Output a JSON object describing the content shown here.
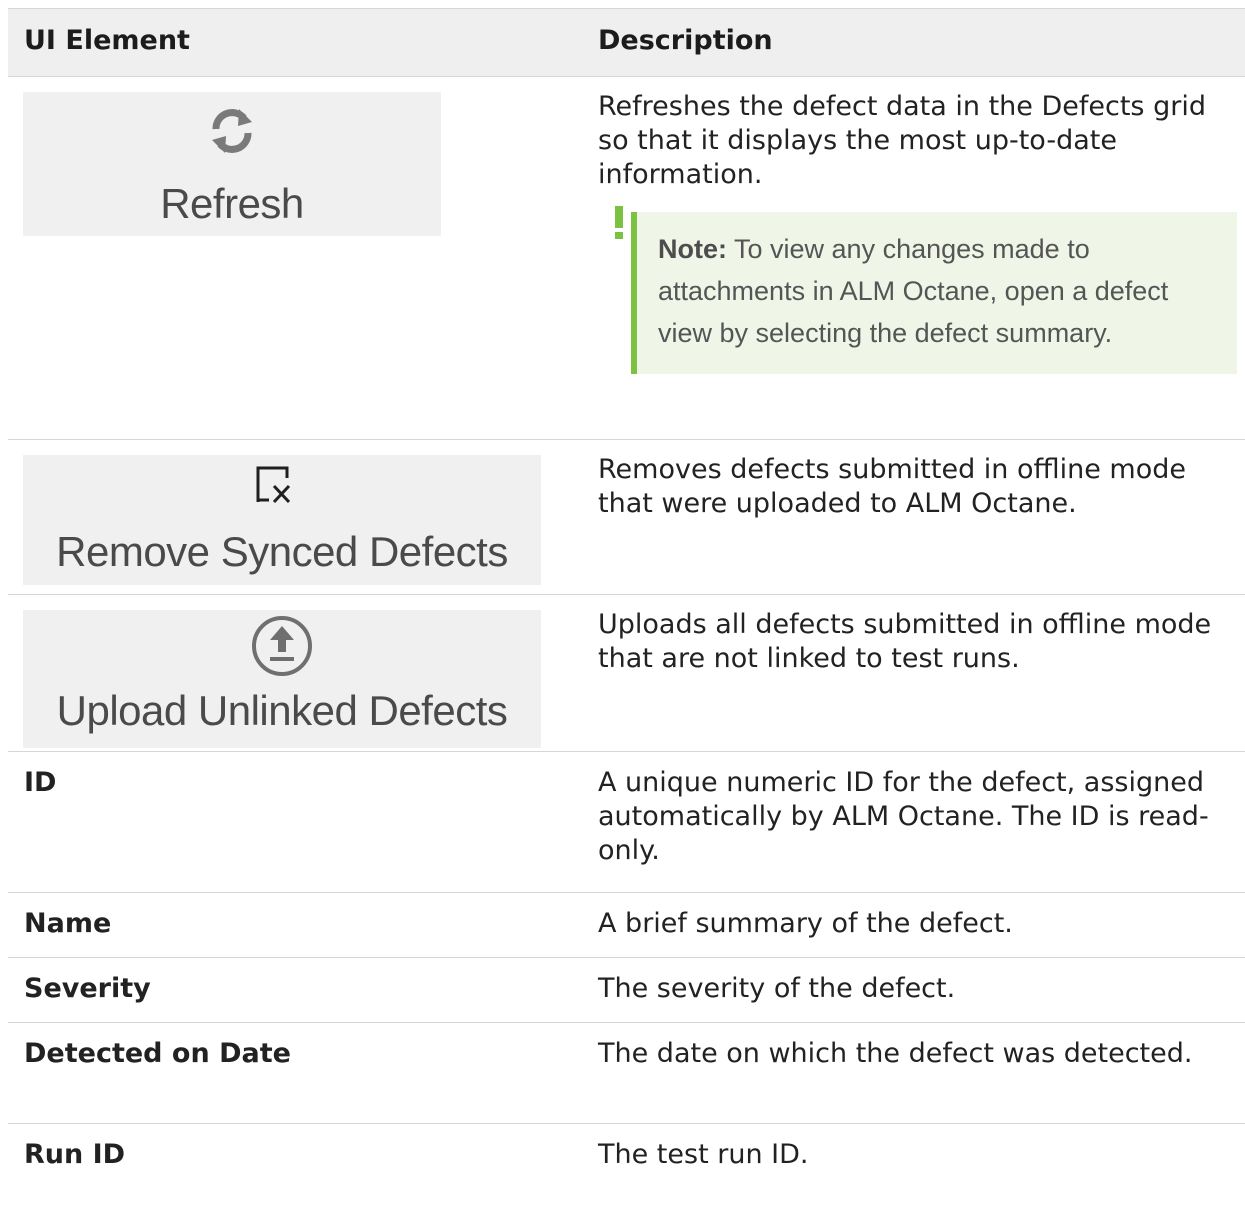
{
  "header": {
    "col_element": "UI Element",
    "col_description": "Description"
  },
  "rows": {
    "refresh": {
      "label": "Refresh",
      "icon": "refresh-icon",
      "description": "Refreshes the defect data in the Defects grid so that it displays the most up-to-date information.",
      "note_label": "Note:",
      "note_text": " To view any changes made to attachments in ALM Octane, open a defect view by selecting the defect summary."
    },
    "remove_synced": {
      "label": "Remove Synced Defects",
      "icon": "remove-synced-icon",
      "description": "Removes defects submitted in offline mode that were uploaded to ALM Octane."
    },
    "upload_unlinked": {
      "label": "Upload Unlinked Defects",
      "icon": "upload-icon",
      "description": "Uploads all defects submitted in offline mode that are not linked to test runs."
    },
    "id": {
      "label": "ID",
      "description": "A unique numeric ID for the defect, assigned automatically by ALM Octane. The ID is read-only."
    },
    "name": {
      "label": "Name",
      "description": "A brief summary of the defect."
    },
    "severity": {
      "label": "Severity",
      "description": "The severity of the defect."
    },
    "detected_on_date": {
      "label": "Detected on Date",
      "description": "The date on which the defect was detected."
    },
    "run_id": {
      "label": "Run ID",
      "description": "The test run ID."
    }
  },
  "colors": {
    "note_border": "#7cc242",
    "note_background": "#eff5e7",
    "header_background": "#efefef",
    "button_background": "#f0f0f0"
  }
}
